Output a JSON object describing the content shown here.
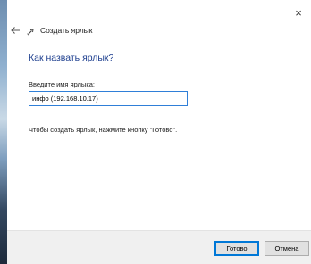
{
  "window": {
    "close_glyph": "×"
  },
  "header": {
    "back_icon": "back-arrow-icon",
    "app_icon": "shortcut-wizard-icon",
    "title": "Создать ярлык"
  },
  "content": {
    "main_instruction": "Как назвать ярлык?",
    "field_label": "Введите имя ярлыка:",
    "name_value": "инфо (192.168.10.17)",
    "hint": "Чтобы создать ярлык, нажмите кнопку \"Готово\"."
  },
  "footer": {
    "ok_label": "Готово",
    "cancel_label": "Отмена"
  },
  "colors": {
    "instruction": "#1e3f8f",
    "focus_border": "#2f7fd8",
    "footer_bg": "#f0f0f0"
  }
}
